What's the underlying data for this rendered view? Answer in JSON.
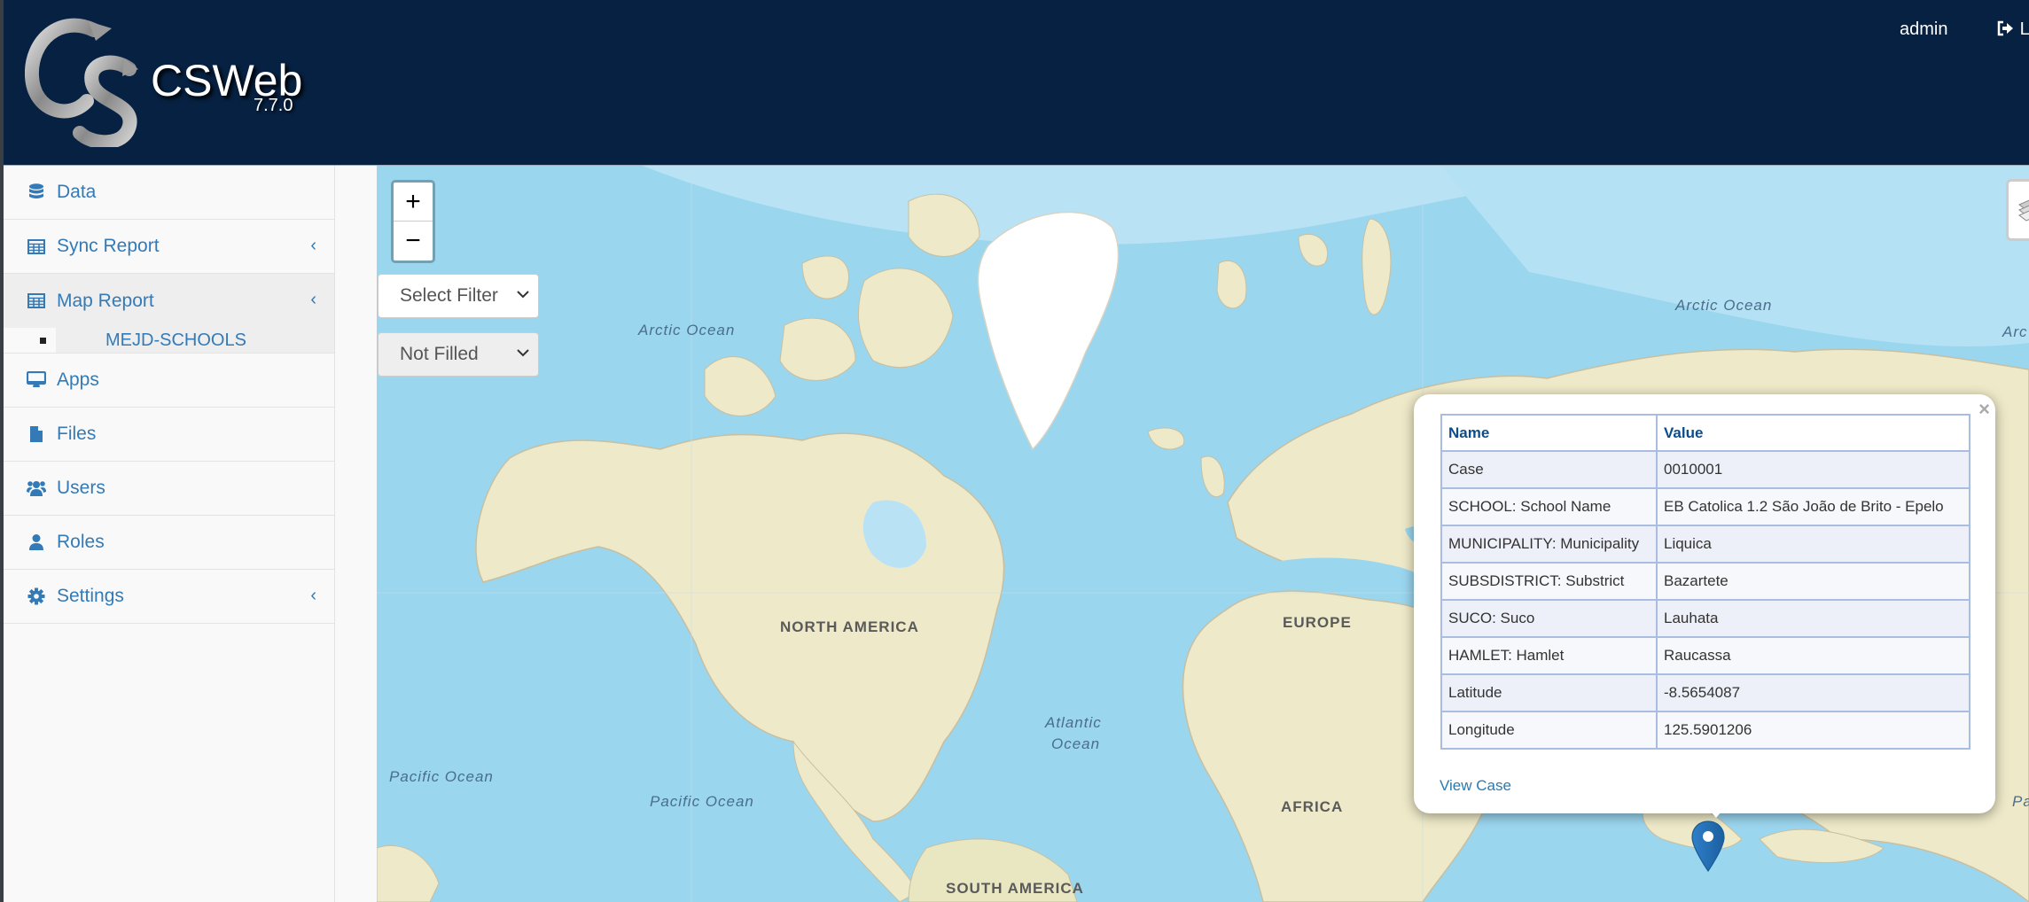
{
  "header": {
    "app_name": "CSWeb",
    "version": "7.7.0",
    "user": "admin",
    "logout_label": "L",
    "logo_icon": "cs-logo-icon",
    "logout_icon": "sign-out-icon"
  },
  "sidebar": {
    "items": [
      {
        "label": "Data",
        "icon": "database-icon",
        "has_chevron": false
      },
      {
        "label": "Sync Report",
        "icon": "table-icon",
        "has_chevron": true
      },
      {
        "label": "Map Report",
        "icon": "table-icon",
        "has_chevron": true,
        "active": true,
        "subitems": [
          {
            "label": "MEJD-SCHOOLS"
          }
        ]
      },
      {
        "label": "Apps",
        "icon": "desktop-icon",
        "has_chevron": false
      },
      {
        "label": "Files",
        "icon": "file-icon",
        "has_chevron": false
      },
      {
        "label": "Users",
        "icon": "users-icon",
        "has_chevron": false
      },
      {
        "label": "Roles",
        "icon": "user-icon",
        "has_chevron": false
      },
      {
        "label": "Settings",
        "icon": "gear-icon",
        "has_chevron": true
      }
    ],
    "chevron_glyph": "‹"
  },
  "map": {
    "zoom_in": "+",
    "zoom_out": "−",
    "filter_select": {
      "selected": "Select Filter"
    },
    "status_select": {
      "selected": "Not Filled"
    },
    "labels": {
      "arctic_ocean_1": "Arctic Ocean",
      "arctic_ocean_2": "Arctic Ocean",
      "arctic_ocean_3": "Arc",
      "north_america": "NORTH AMERICA",
      "europe": "EUROPE",
      "atlantic_1": "Atlantic",
      "atlantic_2": "Ocean",
      "pacific_1": "Pacific Ocean",
      "pacific_2": "Pacific Ocean",
      "pacific_3": "Pa",
      "africa": "AFRICA",
      "south_america": "SOUTH AMERICA"
    },
    "colors": {
      "ocean": "#9bd6ef",
      "land": "#f0ecd0",
      "ice": "#ffffff",
      "marker": "#2a81cb"
    }
  },
  "popup": {
    "close_glyph": "×",
    "columns": [
      "Name",
      "Value"
    ],
    "rows": [
      [
        "Case",
        "0010001"
      ],
      [
        "SCHOOL: School Name",
        "EB Catolica 1.2 São João de Brito - Epelo"
      ],
      [
        "MUNICIPALITY: Municipality",
        "Liquica"
      ],
      [
        "SUBSDISTRICT: Substrict",
        "Bazartete"
      ],
      [
        "SUCO: Suco",
        "Lauhata"
      ],
      [
        "HAMLET: Hamlet",
        "Raucassa"
      ],
      [
        "Latitude",
        "-8.5654087"
      ],
      [
        "Longitude",
        "125.5901206"
      ]
    ],
    "link": "View Case"
  }
}
